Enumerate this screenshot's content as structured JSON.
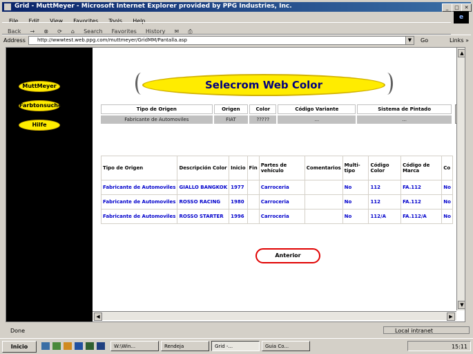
{
  "window": {
    "title": "Grid - MuttMeyer - Microsoft Internet Explorer provided by PPG Industries, Inc."
  },
  "menu": [
    "File",
    "Edit",
    "View",
    "Favorites",
    "Tools",
    "Help"
  ],
  "toolbar": {
    "back": "Back",
    "forward": "→",
    "search": "Search",
    "favorites": "Favorites",
    "history": "History"
  },
  "address": {
    "label": "Address",
    "url": "http://wwwtest.web.ppg.com/muttmeyer/GridMM/Pantalla.asp",
    "go": "Go",
    "links": "Links »"
  },
  "sidebar": {
    "items": [
      "MuttMeyer",
      "Farbtonsuche",
      "Hilfe"
    ]
  },
  "banner": {
    "title": "Selecrom Web Color"
  },
  "filter": {
    "headers": [
      "Tipo de Origen",
      "Origen",
      "Color",
      "Código Variante",
      "Sistema de Pintado"
    ],
    "values": [
      "Fabricante de Automoviles",
      "FIAT",
      "?????",
      "...",
      "..."
    ]
  },
  "results": {
    "headers": [
      "Tipo de Origen",
      "Descripción Color",
      "Inicio",
      "Fin",
      "Partes de vehículo",
      "Comentarios",
      "Multi-tipo",
      "Código Color",
      "Código de Marca",
      "Co"
    ],
    "rows": [
      [
        "Fabricante de Automoviles",
        "GIALLO BANGKOK",
        "1977",
        "",
        "Carroceria",
        "",
        "No",
        "112",
        "FA.112",
        "No"
      ],
      [
        "Fabricante de Automoviles",
        "ROSSO RACING",
        "1980",
        "",
        "Carroceria",
        "",
        "No",
        "112",
        "FA.112",
        "No"
      ],
      [
        "Fabricante de Automoviles",
        "ROSSO STARTER",
        "1996",
        "",
        "Carroceria",
        "",
        "No",
        "112/A",
        "FA.112/A",
        "No"
      ]
    ]
  },
  "anterior_label": "Anterior",
  "status": {
    "text": "Done",
    "zone": "Local intranet"
  },
  "taskbar": {
    "start": "Inicio",
    "tasks": [
      "W:\\Win...",
      "Rendeja",
      "Grid -...",
      "Guia Co..."
    ],
    "time": "15:11"
  }
}
